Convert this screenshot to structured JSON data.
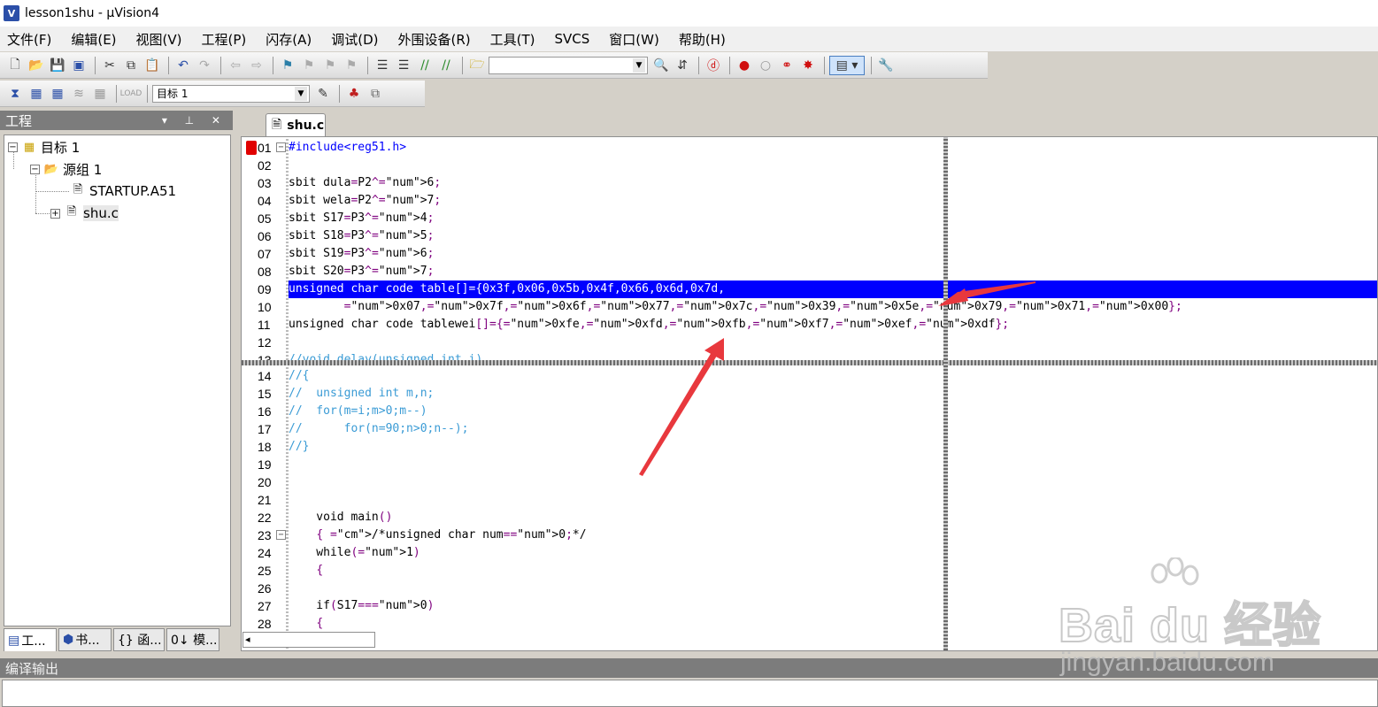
{
  "window": {
    "title": "lesson1shu  - µVision4",
    "icon_label": "V"
  },
  "menu": [
    "文件(F)",
    "编辑(E)",
    "视图(V)",
    "工程(P)",
    "闪存(A)",
    "调试(D)",
    "外围设备(R)",
    "工具(T)",
    "SVCS",
    "窗口(W)",
    "帮助(H)"
  ],
  "toolbar2": {
    "target_combo": "目标 1"
  },
  "project_panel": {
    "title": "工程",
    "tree": {
      "target": "目标 1",
      "group": "源组 1",
      "files": [
        "STARTUP.A51",
        "shu.c"
      ]
    },
    "tabs": [
      "工...",
      "书...",
      "{} 函...",
      "0↓ 模..."
    ]
  },
  "editor": {
    "tab_label": "shu.c",
    "top_pane": [
      {
        "n": "01",
        "text": "#include<reg51.h>"
      },
      {
        "n": "02",
        "text": ""
      },
      {
        "n": "03",
        "text": "sbit dula=P2^6;"
      },
      {
        "n": "04",
        "text": "sbit wela=P2^7;"
      },
      {
        "n": "05",
        "text": "sbit S17=P3^4;"
      },
      {
        "n": "06",
        "text": "sbit S18=P3^5;"
      },
      {
        "n": "07",
        "text": "sbit S19=P3^6;"
      },
      {
        "n": "08",
        "text": "sbit S20=P3^7;"
      },
      {
        "n": "09",
        "text": "unsigned char code table[]={0x3f,0x06,0x5b,0x4f,0x66,0x6d,0x7d,"
      },
      {
        "n": "10",
        "text": "        0x07,0x7f,0x6f,0x77,0x7c,0x39,0x5e,0x79,0x71,0x00};"
      },
      {
        "n": "11",
        "text": "unsigned char code tablewei[]={0xfe,0xfd,0xfb,0xf7,0xef,0xdf};"
      },
      {
        "n": "12",
        "text": ""
      },
      {
        "n": "13",
        "text": "//void delay(unsigned int i)"
      }
    ],
    "bottom_pane": [
      {
        "n": "14",
        "text": "//{"
      },
      {
        "n": "15",
        "text": "//  unsigned int m,n;"
      },
      {
        "n": "16",
        "text": "//  for(m=i;m>0;m--)"
      },
      {
        "n": "17",
        "text": "//      for(n=90;n>0;n--);"
      },
      {
        "n": "18",
        "text": "//}"
      },
      {
        "n": "19",
        "text": ""
      },
      {
        "n": "20",
        "text": ""
      },
      {
        "n": "21",
        "text": ""
      },
      {
        "n": "22",
        "text": "    void main()"
      },
      {
        "n": "23",
        "text": "    { /*unsigned char num=0;*/"
      },
      {
        "n": "24",
        "text": "    while(1)"
      },
      {
        "n": "25",
        "text": "    {"
      },
      {
        "n": "26",
        "text": ""
      },
      {
        "n": "27",
        "text": "    if(S17==0)"
      },
      {
        "n": "28",
        "text": "    {"
      }
    ],
    "highlighted_line": "09"
  },
  "output_panel": {
    "title": "编译输出"
  },
  "watermark": {
    "main": "Bai du 经验",
    "sub": "jingyan.baidu.com"
  },
  "colors": {
    "highlight": "#0000ff",
    "annotation_arrow": "#e8383d",
    "breakpoint": "#e00000"
  }
}
